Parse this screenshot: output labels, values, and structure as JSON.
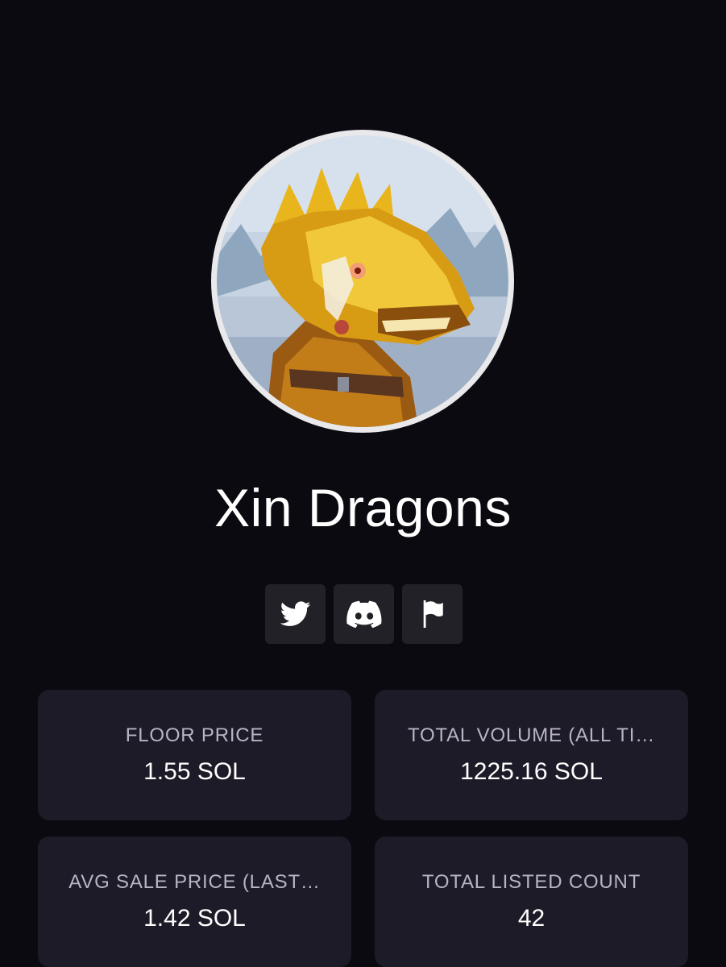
{
  "collection": {
    "name": "Xin Dragons",
    "avatar_alt": "dragon-avatar"
  },
  "socials": [
    {
      "icon": "twitter-icon"
    },
    {
      "icon": "discord-icon"
    },
    {
      "icon": "flag-icon"
    }
  ],
  "stats": {
    "floor_price": {
      "label": "FLOOR PRICE",
      "value": "1.55 SOL"
    },
    "total_volume": {
      "label": "TOTAL VOLUME (ALL TI…",
      "value": "1225.16 SOL"
    },
    "avg_sale_price": {
      "label": "AVG SALE PRICE (LAST…",
      "value": "1.42 SOL"
    },
    "total_listed": {
      "label": "TOTAL LISTED COUNT",
      "value": "42"
    }
  },
  "colors": {
    "background": "#0b0a10",
    "card": "#1d1b27",
    "social_button": "#222127",
    "label": "#b9b3c6",
    "dragon_gold": "#e8b51c",
    "avatar_sky": "#c8d6e6"
  }
}
